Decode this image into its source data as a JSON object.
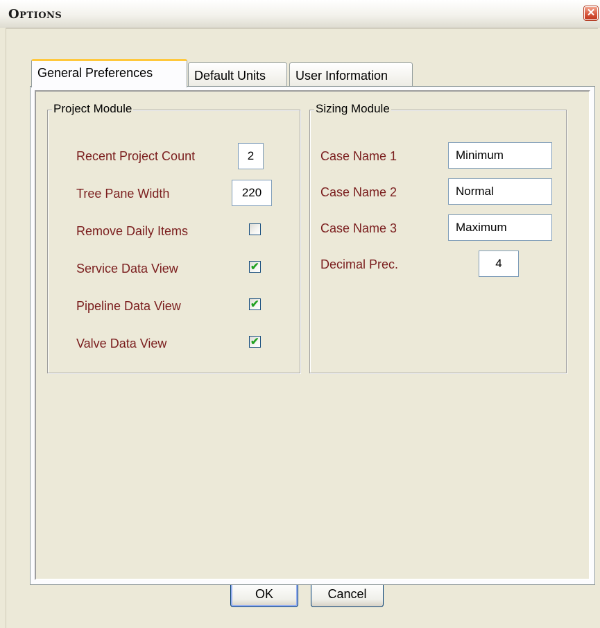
{
  "window": {
    "title": "Options",
    "close_glyph": "✕"
  },
  "tabs": [
    {
      "label": "General Preferences",
      "active": true
    },
    {
      "label": "Default Units",
      "active": false
    },
    {
      "label": "User Information",
      "active": false
    }
  ],
  "project_module": {
    "legend": "Project Module",
    "recent_project_count": {
      "label": "Recent Project Count",
      "value": "2"
    },
    "tree_pane_width": {
      "label": "Tree Pane Width",
      "value": "220"
    },
    "remove_daily_items": {
      "label": "Remove Daily Items",
      "checked": false
    },
    "service_data_view": {
      "label": "Service Data View",
      "checked": true
    },
    "pipeline_data_view": {
      "label": "Pipeline Data View",
      "checked": true
    },
    "valve_data_view": {
      "label": "Valve Data View",
      "checked": true
    }
  },
  "sizing_module": {
    "legend": "Sizing Module",
    "case_name_1": {
      "label": "Case Name 1",
      "value": "Minimum"
    },
    "case_name_2": {
      "label": "Case Name 2",
      "value": "Normal"
    },
    "case_name_3": {
      "label": "Case Name 3",
      "value": "Maximum"
    },
    "decimal_prec": {
      "label": "Decimal Prec.",
      "value": "4"
    }
  },
  "buttons": {
    "ok": "OK",
    "cancel": "Cancel"
  },
  "icons": {
    "close": "close-icon",
    "check": "checkmark-icon"
  },
  "colors": {
    "label_text": "#7a1d1d",
    "active_tab_accent": "#ffc83c",
    "check_green": "#21a121",
    "close_red": "#d6543a"
  }
}
